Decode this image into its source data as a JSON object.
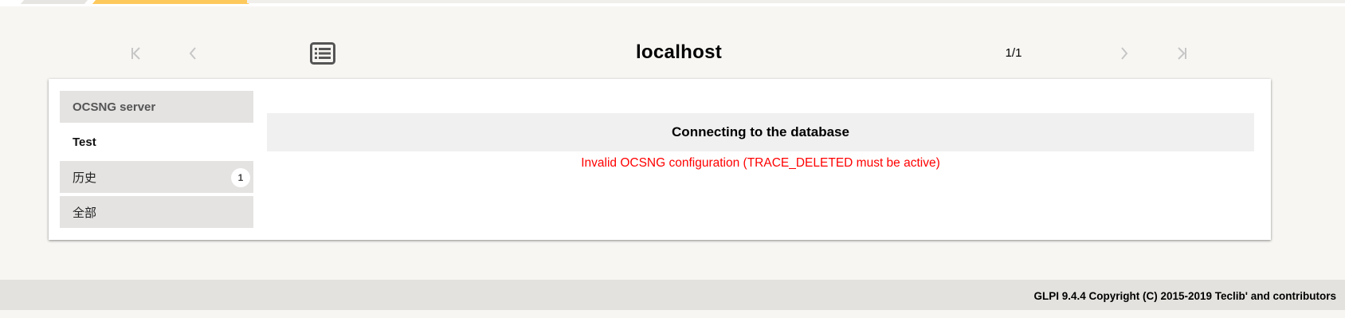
{
  "nav": {
    "first_icon": "first-page-icon",
    "prev_icon": "chevron-left-icon",
    "list_icon": "list-view-icon",
    "title": "localhost",
    "pager": "1/1",
    "next_icon": "chevron-right-icon",
    "last_icon": "last-page-icon"
  },
  "tabs": [
    {
      "label": "OCSNG server",
      "state": "inactive"
    },
    {
      "label": "Test",
      "state": "active"
    },
    {
      "label": "历史",
      "badge": "1",
      "state": "inactive"
    },
    {
      "label": "全部",
      "state": "inactive"
    }
  ],
  "content": {
    "section_title": "Connecting to the database",
    "error_message": "Invalid OCSNG configuration (TRACE_DELETED must be active)"
  },
  "footer": {
    "copyright": "GLPI 9.4.4 Copyright (C) 2015-2019 Teclib' and contributors"
  },
  "colors": {
    "accent_yellow": "#fec95c",
    "error_red": "#ff0000",
    "page_bg": "#f7f6f3",
    "tab_bg": "#e4e3e2"
  }
}
